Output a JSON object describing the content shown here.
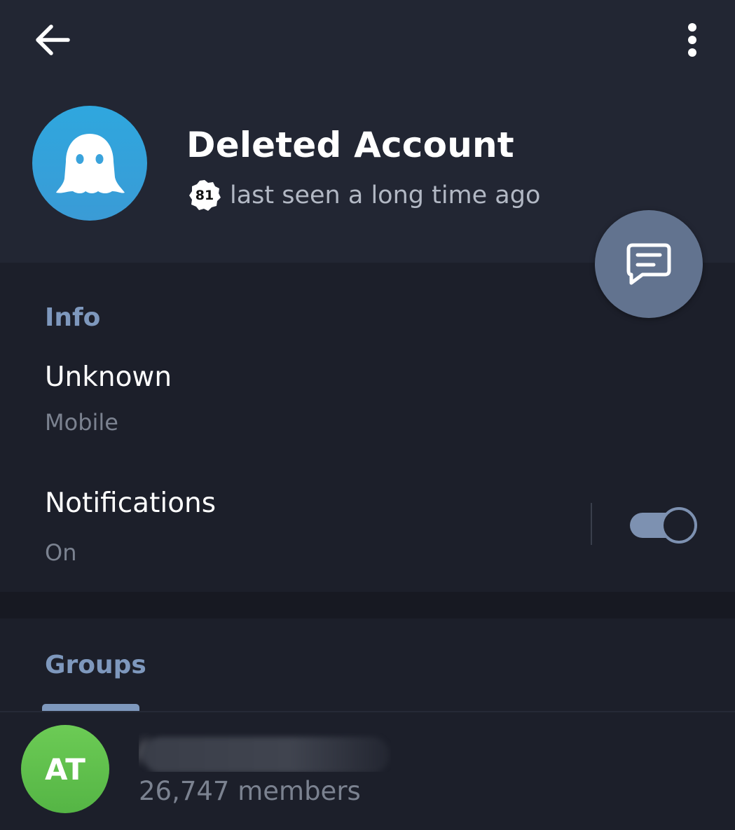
{
  "toolbar": {
    "back_icon": "arrow-left-icon",
    "menu_icon": "more-vertical-icon"
  },
  "profile": {
    "name": "Deleted Account",
    "status": "last seen a long time ago",
    "badge_number": "81",
    "avatar_icon": "ghost-icon",
    "avatar_color": "#2fa7de"
  },
  "fab": {
    "icon": "message-icon",
    "color": "#62738f"
  },
  "info": {
    "title": "Info",
    "phone_value": "Unknown",
    "phone_label": "Mobile",
    "notifications_label": "Notifications",
    "notifications_value": "On",
    "notifications_enabled": true
  },
  "groups": {
    "title": "Groups",
    "items": [
      {
        "initials": "AT",
        "name": "/",
        "members": "26,747 members",
        "avatar_color": "#5fc04d"
      }
    ]
  },
  "colors": {
    "accent": "#7e98bd",
    "background": "#1c1f2a",
    "header": "#222633"
  }
}
